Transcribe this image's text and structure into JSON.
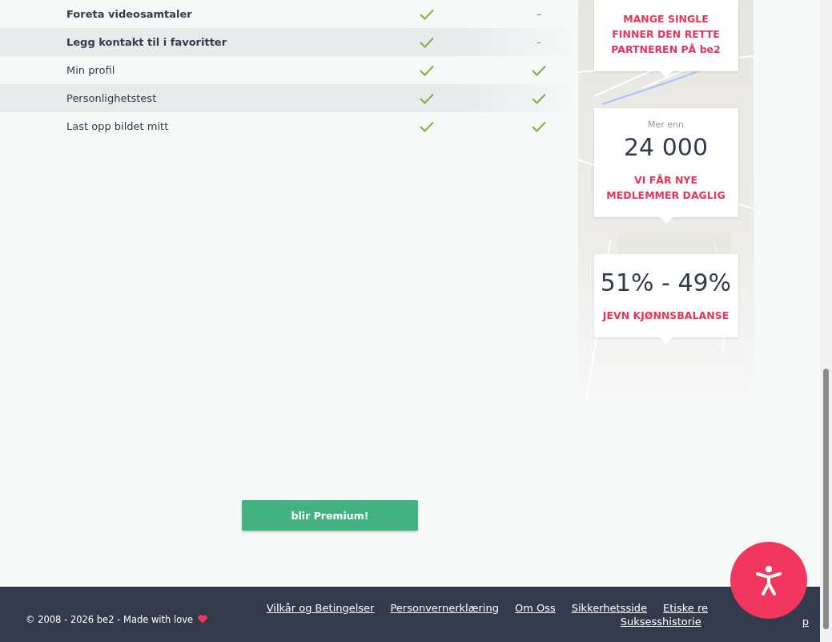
{
  "features": {
    "rows": [
      {
        "label": "Foreta videosamtaler",
        "bold": true,
        "striped": false,
        "cells": [
          {
            "kind": "check"
          },
          {
            "kind": "dash",
            "text": "–"
          }
        ]
      },
      {
        "label": "Legg kontakt til i favoritter",
        "bold": true,
        "striped": true,
        "cells": [
          {
            "kind": "check"
          },
          {
            "kind": "dash",
            "text": "–"
          }
        ]
      },
      {
        "label": "Min profil",
        "bold": false,
        "striped": false,
        "cells": [
          {
            "kind": "check"
          },
          {
            "kind": "check"
          }
        ]
      },
      {
        "label": "Personlighetstest",
        "bold": false,
        "striped": true,
        "cells": [
          {
            "kind": "check"
          },
          {
            "kind": "check"
          }
        ]
      },
      {
        "label": "Last opp bildet mitt",
        "bold": false,
        "striped": false,
        "cells": [
          {
            "kind": "check"
          },
          {
            "kind": "check"
          }
        ]
      }
    ]
  },
  "premium_button": "blir Premium!",
  "stats": [
    {
      "caption": "MANGE SINGLE FINNER DEN RETTE PARTNEREN PÅ be2"
    },
    {
      "prefix": "Mer enn",
      "number": "24 000",
      "caption": "VI FÅR NYE MEDLEMMER DAGLIG"
    },
    {
      "number": "51% - 49%",
      "caption": "JEVN KJØNNSBALANSE"
    }
  ],
  "footer": {
    "copyright": "© 2008 - 2026 be2 - Made with love",
    "links": [
      "Vilkår og Betingelser",
      "Personvernerklæring",
      "Om Oss",
      "Sikkerhetsside",
      "Etiske re"
    ],
    "links_row2": [
      "Suksesshistorie",
      "p"
    ]
  }
}
